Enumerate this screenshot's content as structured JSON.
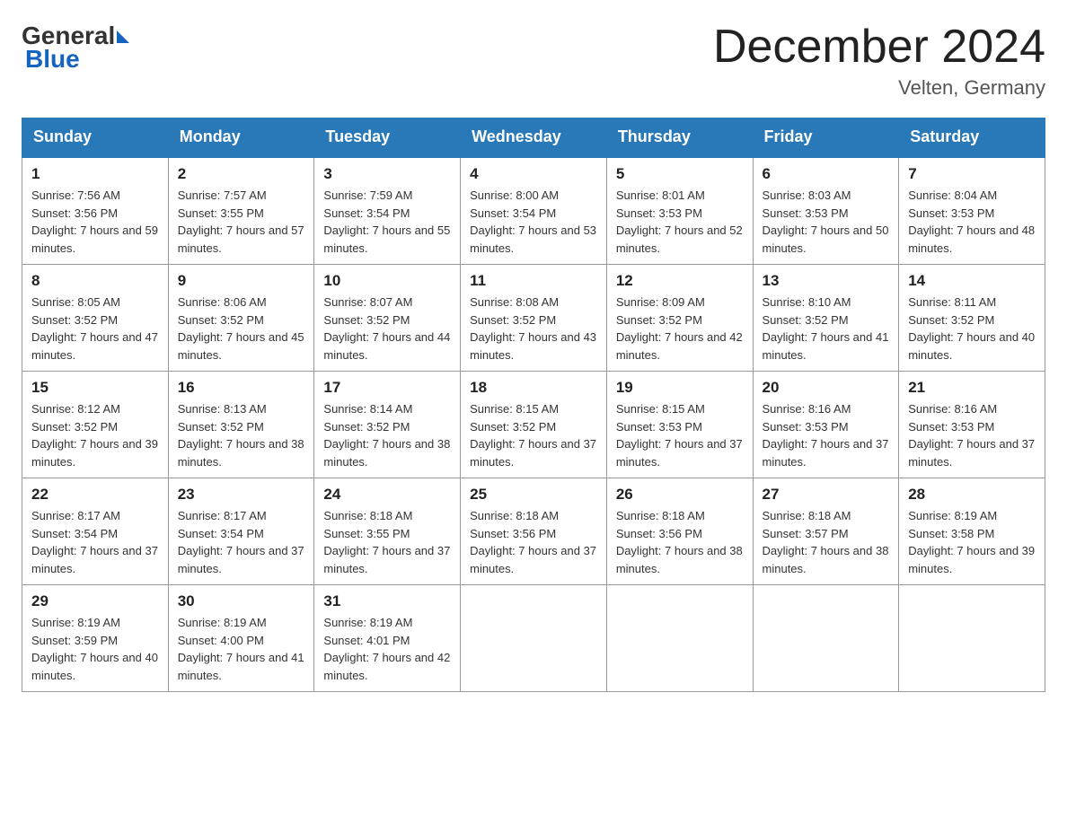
{
  "header": {
    "logo_text_general": "General",
    "logo_text_blue": "Blue",
    "month_title": "December 2024",
    "location": "Velten, Germany"
  },
  "days_of_week": [
    "Sunday",
    "Monday",
    "Tuesday",
    "Wednesday",
    "Thursday",
    "Friday",
    "Saturday"
  ],
  "weeks": [
    [
      {
        "day": "1",
        "sunrise": "7:56 AM",
        "sunset": "3:56 PM",
        "daylight": "7 hours and 59 minutes."
      },
      {
        "day": "2",
        "sunrise": "7:57 AM",
        "sunset": "3:55 PM",
        "daylight": "7 hours and 57 minutes."
      },
      {
        "day": "3",
        "sunrise": "7:59 AM",
        "sunset": "3:54 PM",
        "daylight": "7 hours and 55 minutes."
      },
      {
        "day": "4",
        "sunrise": "8:00 AM",
        "sunset": "3:54 PM",
        "daylight": "7 hours and 53 minutes."
      },
      {
        "day": "5",
        "sunrise": "8:01 AM",
        "sunset": "3:53 PM",
        "daylight": "7 hours and 52 minutes."
      },
      {
        "day": "6",
        "sunrise": "8:03 AM",
        "sunset": "3:53 PM",
        "daylight": "7 hours and 50 minutes."
      },
      {
        "day": "7",
        "sunrise": "8:04 AM",
        "sunset": "3:53 PM",
        "daylight": "7 hours and 48 minutes."
      }
    ],
    [
      {
        "day": "8",
        "sunrise": "8:05 AM",
        "sunset": "3:52 PM",
        "daylight": "7 hours and 47 minutes."
      },
      {
        "day": "9",
        "sunrise": "8:06 AM",
        "sunset": "3:52 PM",
        "daylight": "7 hours and 45 minutes."
      },
      {
        "day": "10",
        "sunrise": "8:07 AM",
        "sunset": "3:52 PM",
        "daylight": "7 hours and 44 minutes."
      },
      {
        "day": "11",
        "sunrise": "8:08 AM",
        "sunset": "3:52 PM",
        "daylight": "7 hours and 43 minutes."
      },
      {
        "day": "12",
        "sunrise": "8:09 AM",
        "sunset": "3:52 PM",
        "daylight": "7 hours and 42 minutes."
      },
      {
        "day": "13",
        "sunrise": "8:10 AM",
        "sunset": "3:52 PM",
        "daylight": "7 hours and 41 minutes."
      },
      {
        "day": "14",
        "sunrise": "8:11 AM",
        "sunset": "3:52 PM",
        "daylight": "7 hours and 40 minutes."
      }
    ],
    [
      {
        "day": "15",
        "sunrise": "8:12 AM",
        "sunset": "3:52 PM",
        "daylight": "7 hours and 39 minutes."
      },
      {
        "day": "16",
        "sunrise": "8:13 AM",
        "sunset": "3:52 PM",
        "daylight": "7 hours and 38 minutes."
      },
      {
        "day": "17",
        "sunrise": "8:14 AM",
        "sunset": "3:52 PM",
        "daylight": "7 hours and 38 minutes."
      },
      {
        "day": "18",
        "sunrise": "8:15 AM",
        "sunset": "3:52 PM",
        "daylight": "7 hours and 37 minutes."
      },
      {
        "day": "19",
        "sunrise": "8:15 AM",
        "sunset": "3:53 PM",
        "daylight": "7 hours and 37 minutes."
      },
      {
        "day": "20",
        "sunrise": "8:16 AM",
        "sunset": "3:53 PM",
        "daylight": "7 hours and 37 minutes."
      },
      {
        "day": "21",
        "sunrise": "8:16 AM",
        "sunset": "3:53 PM",
        "daylight": "7 hours and 37 minutes."
      }
    ],
    [
      {
        "day": "22",
        "sunrise": "8:17 AM",
        "sunset": "3:54 PM",
        "daylight": "7 hours and 37 minutes."
      },
      {
        "day": "23",
        "sunrise": "8:17 AM",
        "sunset": "3:54 PM",
        "daylight": "7 hours and 37 minutes."
      },
      {
        "day": "24",
        "sunrise": "8:18 AM",
        "sunset": "3:55 PM",
        "daylight": "7 hours and 37 minutes."
      },
      {
        "day": "25",
        "sunrise": "8:18 AM",
        "sunset": "3:56 PM",
        "daylight": "7 hours and 37 minutes."
      },
      {
        "day": "26",
        "sunrise": "8:18 AM",
        "sunset": "3:56 PM",
        "daylight": "7 hours and 38 minutes."
      },
      {
        "day": "27",
        "sunrise": "8:18 AM",
        "sunset": "3:57 PM",
        "daylight": "7 hours and 38 minutes."
      },
      {
        "day": "28",
        "sunrise": "8:19 AM",
        "sunset": "3:58 PM",
        "daylight": "7 hours and 39 minutes."
      }
    ],
    [
      {
        "day": "29",
        "sunrise": "8:19 AM",
        "sunset": "3:59 PM",
        "daylight": "7 hours and 40 minutes."
      },
      {
        "day": "30",
        "sunrise": "8:19 AM",
        "sunset": "4:00 PM",
        "daylight": "7 hours and 41 minutes."
      },
      {
        "day": "31",
        "sunrise": "8:19 AM",
        "sunset": "4:01 PM",
        "daylight": "7 hours and 42 minutes."
      },
      null,
      null,
      null,
      null
    ]
  ]
}
